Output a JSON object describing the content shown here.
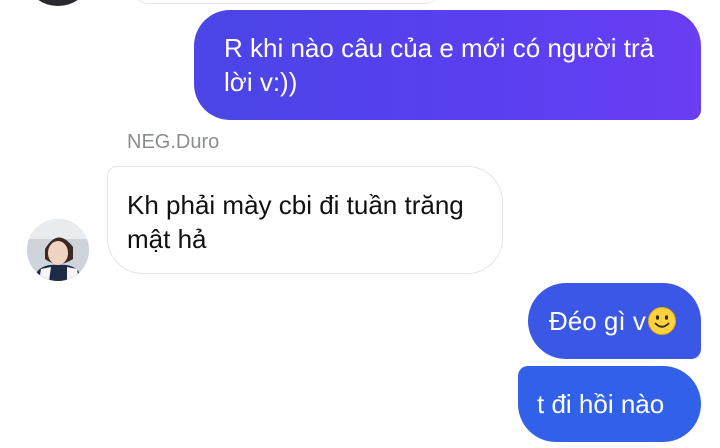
{
  "conversation": {
    "contact_name": "NEG.Duro",
    "messages": [
      {
        "direction": "outgoing",
        "text": "R khi nào câu của e mới có người trả lời v:))"
      },
      {
        "direction": "incoming",
        "text": "Kh phải mày cbi đi tuần trăng mật hả"
      },
      {
        "direction": "outgoing",
        "text": "Đéo gì v",
        "emoji": "slightly-smiling-face-icon"
      },
      {
        "direction": "outgoing",
        "text": "t đi hồi nào"
      }
    ]
  },
  "colors": {
    "outgoing_bubble": "#4f46e5",
    "incoming_bubble": "#ffffff",
    "sender_name": "#8a8d91"
  }
}
